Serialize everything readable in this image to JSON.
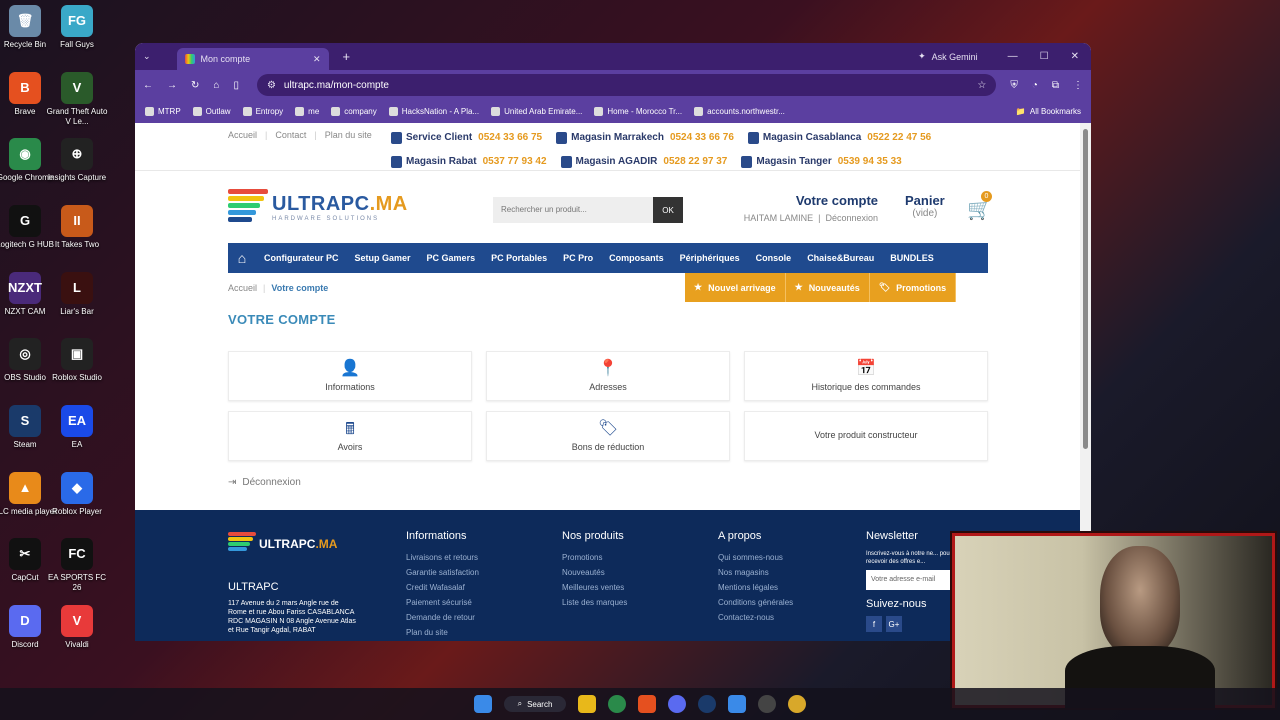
{
  "desktop": {
    "icons": [
      {
        "label": "Recycle Bin",
        "color": "#6a8aa8",
        "glyph": "🗑"
      },
      {
        "label": "Fall Guys",
        "color": "#3aa8c8",
        "glyph": "FG"
      },
      {
        "label": "Brave",
        "color": "#e5501f",
        "glyph": "B"
      },
      {
        "label": "Grand Theft Auto V Le...",
        "color": "#2a5a2a",
        "glyph": "V"
      },
      {
        "label": "Google Chrome",
        "color": "#2a8a4a",
        "glyph": "◉"
      },
      {
        "label": "Insights Capture",
        "color": "#222",
        "glyph": "⊕"
      },
      {
        "label": "Logitech G HUB",
        "color": "#111",
        "glyph": "G"
      },
      {
        "label": "It Takes Two",
        "color": "#c85a1a",
        "glyph": "II"
      },
      {
        "label": "NZXT CAM",
        "color": "#4a2a7a",
        "glyph": "NZXT"
      },
      {
        "label": "Liar's Bar",
        "color": "#3a1010",
        "glyph": "L"
      },
      {
        "label": "OBS Studio",
        "color": "#222",
        "glyph": "◎"
      },
      {
        "label": "Roblox Studio",
        "color": "#222",
        "glyph": "▣"
      },
      {
        "label": "Steam",
        "color": "#1a3a6a",
        "glyph": "S"
      },
      {
        "label": "EA",
        "color": "#1a4ae8",
        "glyph": "EA"
      },
      {
        "label": "VLC media player",
        "color": "#e88a1a",
        "glyph": "▲"
      },
      {
        "label": "Roblox Player",
        "color": "#2a6ae8",
        "glyph": "◆"
      },
      {
        "label": "CapCut",
        "color": "#111",
        "glyph": "✂"
      },
      {
        "label": "EA SPORTS FC 26",
        "color": "#111",
        "glyph": "FC"
      },
      {
        "label": "Discord",
        "color": "#5a6af0",
        "glyph": "D"
      },
      {
        "label": "Vivaldi",
        "color": "#e83a3a",
        "glyph": "V"
      }
    ]
  },
  "browser": {
    "tab_title": "Mon compte",
    "gemini": "Ask Gemini",
    "url": "ultrapc.ma/mon-compte",
    "bookmarks": [
      "MTRP",
      "Outlaw",
      "Entropy",
      "me",
      "company",
      "HacksNation - A Pla...",
      "United Arab Emirate...",
      "Home - Morocco Tr...",
      "accounts.northwestr..."
    ],
    "all_bookmarks": "All Bookmarks"
  },
  "site": {
    "toplinks": [
      "Accueil",
      "Contact",
      "Plan du site"
    ],
    "stores": [
      {
        "name": "Service Client",
        "num": "0524 33 66 75"
      },
      {
        "name": "Magasin Marrakech",
        "num": "0524 33 66 76"
      },
      {
        "name": "Magasin Casablanca",
        "num": "0522 22 47 56"
      },
      {
        "name": "Magasin Rabat",
        "num": "0537 77 93 42"
      },
      {
        "name": "Magasin AGADIR",
        "num": "0528 22 97 37"
      },
      {
        "name": "Magasin Tanger",
        "num": "0539 94 35 33"
      }
    ],
    "brand": "ULTRAPC",
    "brand_ext": ".MA",
    "brand_sub": "HARDWARE SOLUTIONS",
    "search_placeholder": "Rechercher un produit...",
    "search_btn": "OK",
    "account_title": "Votre compte",
    "account_user": "HAITAM LAMINE",
    "account_logout": "Déconnexion",
    "cart_title": "Panier",
    "cart_sub": "(vide)",
    "cart_count": "0",
    "menu": [
      "Configurateur PC",
      "Setup Gamer",
      "PC Gamers",
      "PC Portables",
      "PC Pro",
      "Composants",
      "Périphériques",
      "Console",
      "Chaise&Bureau",
      "BUNDLES"
    ],
    "crumb_home": "Accueil",
    "crumb_current": "Votre compte",
    "promos": [
      "Nouvel arrivage",
      "Nouveautés",
      "Promotions"
    ],
    "page_title": "VOTRE COMPTE",
    "cards": [
      {
        "label": "Informations",
        "icon": "👤"
      },
      {
        "label": "Adresses",
        "icon": "📍"
      },
      {
        "label": "Historique des commandes",
        "icon": "📅"
      },
      {
        "label": "Avoirs",
        "icon": "🖩"
      },
      {
        "label": "Bons de réduction",
        "icon": "🏷"
      },
      {
        "label": "Votre produit constructeur",
        "icon": ""
      }
    ],
    "logout": "Déconnexion"
  },
  "footer": {
    "name": "ULTRAPC",
    "address": "117 Avenue du 2 mars Angle rue de Rome et rue Abou Fariss CASABLANCA RDC MAGASIN N 08 Angle Avenue Atlas et Rue Tangir Agdal, RABAT",
    "cols": [
      {
        "h": "Informations",
        "links": [
          "Livraisons et retours",
          "Garantie satisfaction",
          "Credit Wafasalaf",
          "Paiement sécurisé",
          "Demande de retour",
          "Plan du site"
        ]
      },
      {
        "h": "Nos produits",
        "links": [
          "Promotions",
          "Nouveautés",
          "Meilleures ventes",
          "Liste des marques"
        ]
      },
      {
        "h": "A propos",
        "links": [
          "Qui sommes-nous",
          "Nos magasins",
          "Mentions légales",
          "Conditions générales",
          "Contactez-nous"
        ]
      }
    ],
    "newsletter": "Newsletter",
    "newsletter_text": "Inscrivez-vous à notre ne... pour recevoir des offres e...",
    "newsletter_ph": "Votre adresse e-mail",
    "follow": "Suivez-nous"
  },
  "taskbar": {
    "search": "Search"
  }
}
